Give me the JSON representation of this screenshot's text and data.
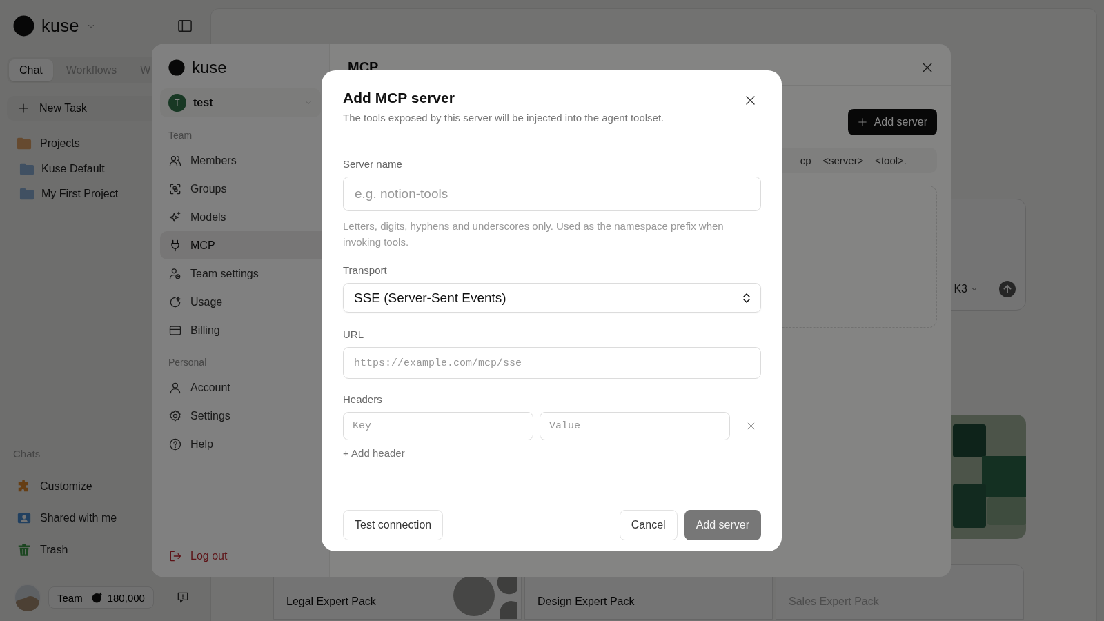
{
  "sidebar": {
    "brand": "kuse",
    "tabs": [
      {
        "label": "Chat",
        "selected": true
      },
      {
        "label": "Workflows",
        "selected": false
      },
      {
        "label": "W",
        "selected": false
      }
    ],
    "new_task": "New Task",
    "projects_label": "Projects",
    "projects": [
      "Kuse Default",
      "My First Project"
    ],
    "chats_label": "Chats",
    "items": [
      "Customize",
      "Shared with me",
      "Trash"
    ],
    "footer": {
      "team": "Team",
      "credits": "180,000"
    }
  },
  "main": {
    "composer_model": "K3",
    "packs": [
      {
        "title": "Legal Expert Pack",
        "disabled": false
      },
      {
        "title": "Design Expert Pack",
        "disabled": false
      },
      {
        "title": "Sales Expert Pack",
        "disabled": true
      }
    ]
  },
  "settings": {
    "brand": "kuse",
    "team": {
      "avatar": "T",
      "name": "test"
    },
    "sections": [
      {
        "title": "Team",
        "items": [
          {
            "label": "Members",
            "selected": false
          },
          {
            "label": "Groups",
            "selected": false
          },
          {
            "label": "Models",
            "selected": false
          },
          {
            "label": "MCP",
            "selected": true
          },
          {
            "label": "Team settings",
            "selected": false
          },
          {
            "label": "Usage",
            "selected": false
          },
          {
            "label": "Billing",
            "selected": false
          }
        ]
      },
      {
        "title": "Personal",
        "items": [
          {
            "label": "Account",
            "selected": false
          },
          {
            "label": "Settings",
            "selected": false
          },
          {
            "label": "Help",
            "selected": false
          }
        ]
      }
    ],
    "logout": "Log out",
    "page_title": "MCP",
    "add_button": "Add server",
    "note": "cp__<server>__<tool>."
  },
  "dialog": {
    "title": "Add MCP server",
    "subtitle": "The tools exposed by this server will be injected into the agent toolset.",
    "server_name": {
      "label": "Server name",
      "placeholder": "e.g. notion-tools",
      "hint": "Letters, digits, hyphens and underscores only. Used as the namespace prefix when invoking tools."
    },
    "transport": {
      "label": "Transport",
      "value": "SSE (Server-Sent Events)"
    },
    "url": {
      "label": "URL",
      "placeholder": "https://example.com/mcp/sse"
    },
    "headers": {
      "label": "Headers",
      "key_placeholder": "Key",
      "value_placeholder": "Value",
      "add": "+ Add header"
    },
    "buttons": [
      {
        "label": "Test connection",
        "kind": "secondary",
        "disabled": false
      },
      {
        "label": "Cancel",
        "kind": "secondary",
        "disabled": false
      },
      {
        "label": "Add server",
        "kind": "primary",
        "disabled": true
      }
    ]
  }
}
